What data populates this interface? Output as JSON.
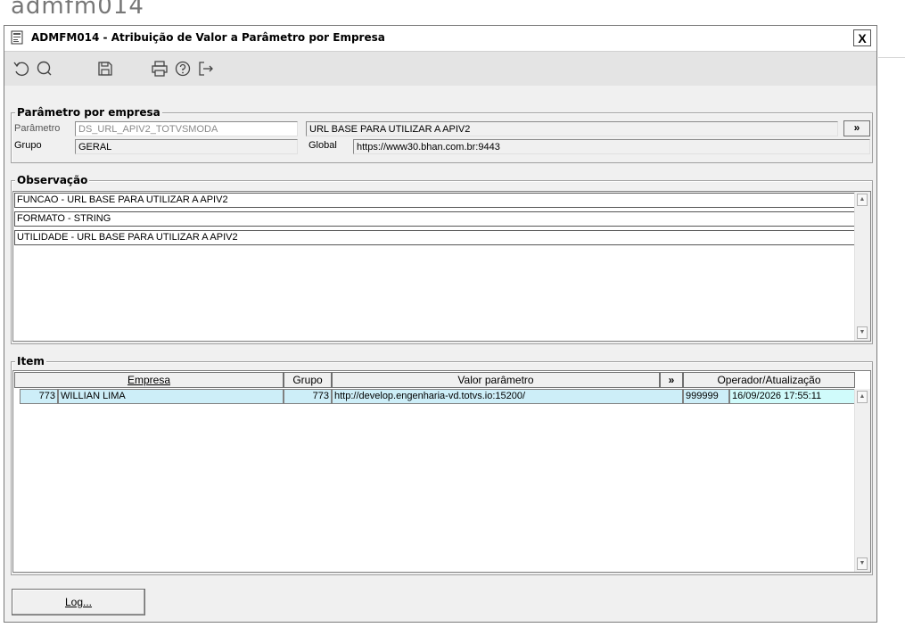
{
  "background_title": "admfm014",
  "window": {
    "title": "ADMFM014 - Atribuição de Valor a Parâmetro por Empresa",
    "close_label": "X"
  },
  "toolbar": {
    "icons": [
      "undo-icon",
      "search-icon",
      "save-icon",
      "print-icon",
      "help-icon",
      "exit-icon"
    ]
  },
  "parametro_group": {
    "legend": "Parâmetro por empresa",
    "parametro_label": "Parâmetro",
    "parametro_value": "DS_URL_APIV2_TOTVSMODA",
    "descricao_value": "URL BASE PARA UTILIZAR A APIV2",
    "expand_label": "»",
    "grupo_label": "Grupo",
    "grupo_value": "GERAL",
    "global_label": "Global",
    "global_value": "https://www30.bhan.com.br:9443"
  },
  "observacao_group": {
    "legend": "Observação",
    "lines": [
      "FUNCAO - URL BASE PARA UTILIZAR A APIV2",
      "FORMATO - STRING",
      "UTILIDADE - URL BASE PARA UTILIZAR A APIV2"
    ]
  },
  "item_group": {
    "legend": "Item",
    "headers": {
      "empresa": "Empresa",
      "grupo": "Grupo",
      "valor": "Valor parâmetro",
      "expand": "»",
      "operador": "Operador/Atualização"
    },
    "rows": [
      {
        "empresa_code": "773",
        "empresa_name": "WILLIAN LIMA",
        "grupo": "773",
        "valor": "http://develop.engenharia-vd.totvs.io:15200/",
        "operador": "999999",
        "atualizacao": "16/09/2026 17:55:11"
      }
    ]
  },
  "log_button": {
    "label": "Log..."
  },
  "colors": {
    "selected_row": "#cdeef8",
    "date_cell": "#d0fbfb",
    "toolbar_bg": "#e4e4e4"
  }
}
